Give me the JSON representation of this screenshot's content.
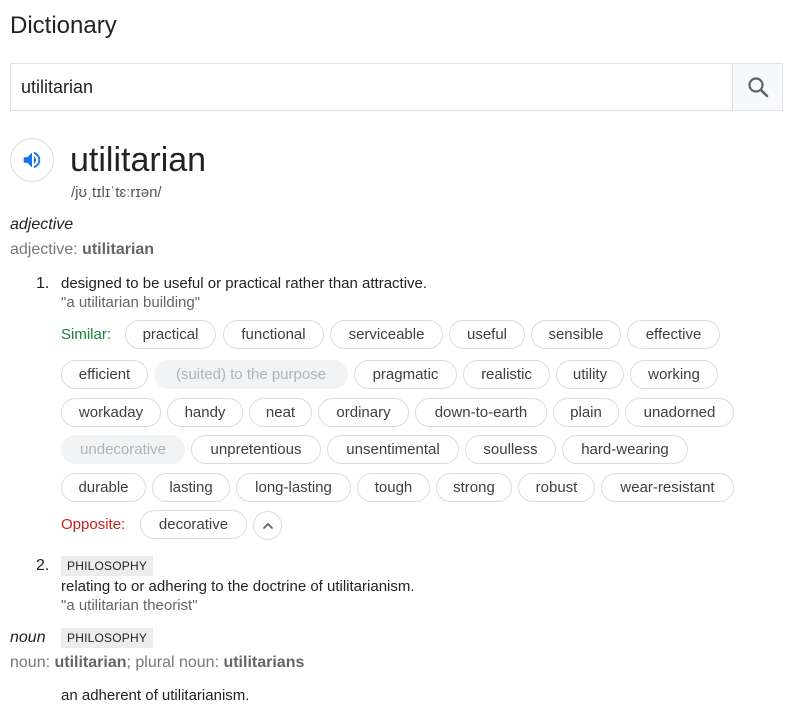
{
  "header": {
    "title": "Dictionary"
  },
  "search": {
    "value": "utilitarian",
    "button_icon": "search-icon"
  },
  "entry": {
    "speaker_icon": "speaker-icon",
    "word": "utilitarian",
    "phonetic": "/jʊˌtɪlɪˈtɛːrɪən/"
  },
  "adjective": {
    "pos": "adjective",
    "forms_prefix": "adjective: ",
    "forms_word": "utilitarian",
    "senses": [
      {
        "number": "1.",
        "definition": "designed to be useful or practical rather than attractive.",
        "example": "\"a utilitarian building\"",
        "similar_label": "Similar:",
        "similar": [
          "practical",
          "functional",
          "serviceable",
          "useful",
          "sensible",
          "effective",
          "efficient",
          "(suited) to the purpose",
          "pragmatic",
          "realistic",
          "utility",
          "working",
          "workaday",
          "handy",
          "neat",
          "ordinary",
          "down-to-earth",
          "plain",
          "unadorned",
          "undecorative",
          "unpretentious",
          "unsentimental",
          "soulless",
          "hard-wearing",
          "durable",
          "lasting",
          "long-lasting",
          "tough",
          "strong",
          "robust",
          "wear-resistant"
        ],
        "opposite_label": "Opposite:",
        "opposite": [
          "decorative"
        ],
        "expand_icon": "chevron-up-icon"
      },
      {
        "number": "2.",
        "domain": "PHILOSOPHY",
        "definition": "relating to or adhering to the doctrine of utilitarianism.",
        "example": "\"a utilitarian theorist\""
      }
    ]
  },
  "noun": {
    "pos": "noun",
    "domain": "PHILOSOPHY",
    "forms_prefix": "noun: ",
    "forms_word": "utilitarian",
    "forms_sep": "; plural noun: ",
    "forms_plural": "utilitarians",
    "definition": "an adherent of utilitarianism."
  }
}
